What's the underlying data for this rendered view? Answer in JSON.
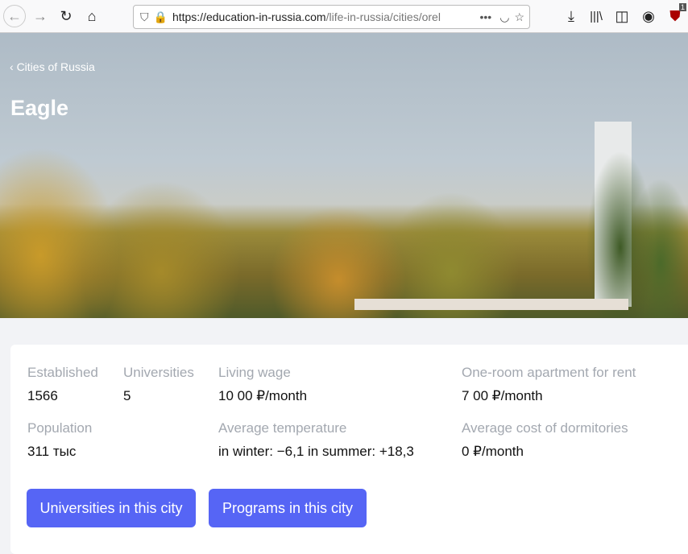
{
  "browser": {
    "url_host": "https://education-in-russia.com",
    "url_path": "/life-in-russia/cities/orel",
    "badge_count": "1"
  },
  "hero": {
    "breadcrumb": "Cities of Russia",
    "title": "Eagle"
  },
  "facts": [
    {
      "label": "Established",
      "value": "1566"
    },
    {
      "label": "Universities",
      "value": "5"
    },
    {
      "label": "Living wage",
      "value": "10 00 ₽/month"
    },
    {
      "label": "One-room apartment for rent",
      "value": "7 00 ₽/month"
    },
    {
      "label": "Population",
      "value": "311 тыс"
    },
    {
      "label": "Average temperature",
      "value": "in winter: −6,1 in summer: +18,3"
    },
    {
      "label": "Average cost of dormitories",
      "value": "0 ₽/month"
    }
  ],
  "buttons": {
    "universities": "Universities in this city",
    "programs": "Programs in this city"
  },
  "colors": {
    "accent": "#5665f5"
  }
}
